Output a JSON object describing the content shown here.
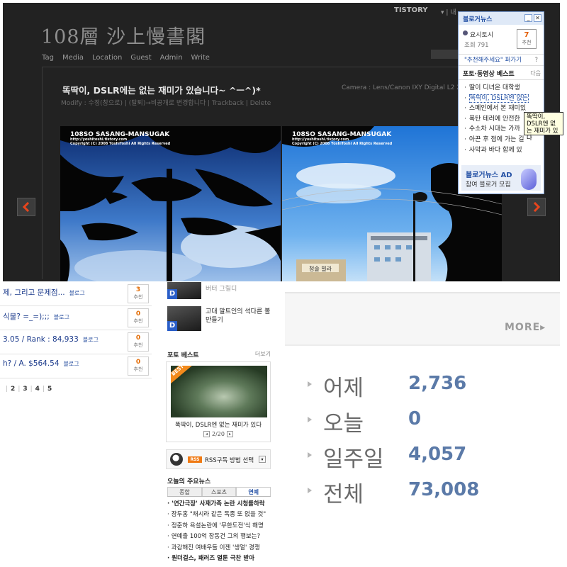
{
  "blog": {
    "title": "108層 沙上慢書閣",
    "nav": [
      "Tag",
      "Media",
      "Location",
      "Guest",
      "Admin",
      "Write"
    ],
    "post_title": "똑딱이, DSLR에는 없는 재미가 있습니다~ ^ㅡ^)*",
    "post_meta": "Modify : 수정(창으로) | (탈퇴)→비공개로 변경합니다 | Trackback | Delete",
    "camera": "Camera : Lens/Canon IXY Digital L2 2",
    "watermark_title": "108SO SASANG-MANSUGAK",
    "watermark_url": "http://yoshitoshi.tistory.com",
    "watermark_copy": "Copyright (C) 2008 YoshiToshi All Rights Reserved",
    "sign_text": "청솔 빌라",
    "tistory": "TISTORY",
    "tistory_extra": "▾ | 내"
  },
  "widget": {
    "title": "블로거뉴스",
    "user": "요시토시",
    "views": "조회 791",
    "rec_count": "7",
    "rec_label": "추천",
    "suggest": "\"추천해주세요\" 퍼가기",
    "suggest_q": "?",
    "best_title": "포토·동영상 베스트",
    "best_more": "다음",
    "best_list": [
      "딸이 디녀온 대학생",
      "똑딱이, DSLR엔 없는",
      "스페인에서 본 재미있",
      "폭탄 테러에 안전한",
      "수소차 시대는 가까",
      "아끈 후 접에 가는 길",
      "사막과 바다 함께 있"
    ],
    "ad_title": "블로거뉴스 AD",
    "ad_sub": "참여 블로거 모집",
    "tooltip": "똑딱이, DSLR엔 없는 재미가 있다"
  },
  "list": {
    "rows": [
      {
        "text": "제, 그리고 문제점...",
        "tag": "블로그",
        "count": "3",
        "label": "추천"
      },
      {
        "text": "식물? =_=);;;",
        "tag": "블로그",
        "count": "0",
        "label": "추천"
      },
      {
        "text": "3.05 / Rank : 84,933",
        "tag": "블로그",
        "count": "0",
        "label": "추천"
      },
      {
        "text": "h? / A. $564.54",
        "tag": "블로그",
        "count": "0",
        "label": "추천"
      }
    ],
    "pages": [
      "2",
      "3",
      "4",
      "5"
    ]
  },
  "news": {
    "item1": "버터 그릴디",
    "item2_l1": "고대 말트인의 석다른 볼",
    "item2_l2": "만들기",
    "photo_best": "포토 베스트",
    "photo_more": "더보기",
    "badge": "BEST",
    "caption": "똑딱이, DSLR엔 없는 재미가 있다",
    "pager": "2/20",
    "rss": "RSS구독 방법 선택",
    "rss_badge": "RSS",
    "today": "오늘의 주요뉴스",
    "tabs": [
      "종합",
      "스포츠",
      "연예"
    ],
    "active_tab": 2,
    "headlines": [
      {
        "t": "'연간극장' 사재가족 논란 시청률하락",
        "b": true
      },
      {
        "t": "장두홍 \"채시라 같은 독종 또 없을 것\"",
        "b": false
      },
      {
        "t": "정준하 욕설논란에 '무한도전'식 해명",
        "b": false
      },
      {
        "t": "연예출 100억 장동건 그의 행보는?",
        "b": false
      },
      {
        "t": "과감해진 여배우들 이젠 '생얼' 경쟁",
        "b": false
      },
      {
        "t": "원더걸스, 패러즈 열툰 극찬 받아",
        "b": true
      }
    ]
  },
  "counter": {
    "more": "MORE▸",
    "rows": [
      {
        "label": "어제",
        "value": "2,736"
      },
      {
        "label": "오늘",
        "value": "0"
      },
      {
        "label": "일주일",
        "value": "4,057"
      },
      {
        "label": "전체",
        "value": "73,008"
      }
    ]
  }
}
